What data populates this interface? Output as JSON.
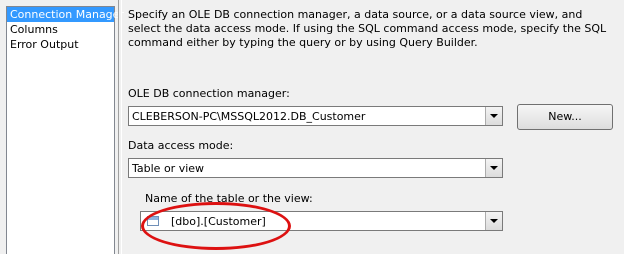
{
  "nav": {
    "items": [
      {
        "label": "Connection Manager",
        "selected": true
      },
      {
        "label": "Columns",
        "selected": false
      },
      {
        "label": "Error Output",
        "selected": false
      }
    ]
  },
  "description": "Specify an OLE DB connection manager, a data source, or a data source view, and select the data access mode. If using the SQL command access mode, specify the SQL command either by typing the query or by using Query Builder.",
  "connection_manager": {
    "label": "OLE DB connection manager:",
    "value": "CLEBERSON-PC\\MSSQL2012.DB_Customer",
    "new_button": "New..."
  },
  "data_access_mode": {
    "label": "Data access mode:",
    "value": "Table or view"
  },
  "table_name": {
    "label": "Name of the table or the view:",
    "value": "[dbo].[Customer]"
  },
  "colors": {
    "selection": "#3399ff",
    "highlight_ellipse": "#dd1111"
  }
}
